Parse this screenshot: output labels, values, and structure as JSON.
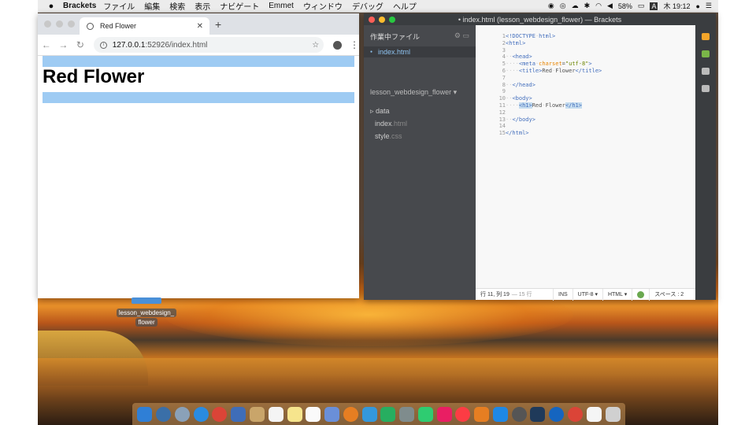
{
  "menubar": {
    "app_name": "Brackets",
    "items": [
      "ファイル",
      "編集",
      "検索",
      "表示",
      "ナビゲート",
      "Emmet",
      "ウィンドウ",
      "デバッグ",
      "ヘルプ"
    ],
    "battery": "58%",
    "input_source": "A",
    "clock": "木 19:12"
  },
  "browser": {
    "tab_title": "Red Flower",
    "url_host": "127.0.0.1",
    "url_rest": ":52926/index.html",
    "page_heading": "Red Flower"
  },
  "desktop": {
    "folder_label_line1": "lesson_webdesign_",
    "folder_label_line2": "flower"
  },
  "brackets": {
    "window_title": "• index.html (lesson_webdesign_flower) — Brackets",
    "sidebar_header": "作業中ファイル",
    "working_file": "index.html",
    "project_name": "lesson_webdesign_flower ▾",
    "tree": [
      {
        "name": "▹ data",
        "ext": ""
      },
      {
        "name": "index",
        "ext": ".html"
      },
      {
        "name": "style",
        "ext": ".css"
      }
    ],
    "line_numbers": [
      "1",
      "2",
      "3",
      "4",
      "5",
      "6",
      "7",
      "8",
      "9",
      "10",
      "11",
      "12",
      "13",
      "14",
      "15"
    ],
    "status": {
      "position": "行 11, 列 19",
      "line_count": "— 15 行",
      "mode": "INS",
      "encoding": "UTF-8 ▾",
      "language": "HTML ▾",
      "indent": "スペース : 2"
    }
  },
  "colors": {
    "highlight_bar": "#9ecbf3",
    "sidebar_bg": "#47494d",
    "editor_bg": "#f8f8f8"
  }
}
